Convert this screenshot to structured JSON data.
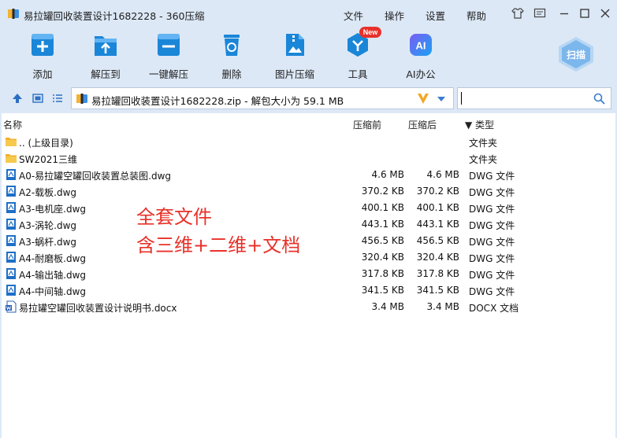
{
  "window": {
    "title": "易拉罐回收装置设计1682228 - 360压缩",
    "menus": [
      "文件",
      "操作",
      "设置",
      "帮助"
    ]
  },
  "toolbar": {
    "items": [
      {
        "label": "添加",
        "icon": "add-icon"
      },
      {
        "label": "解压到",
        "icon": "extract-to-icon"
      },
      {
        "label": "一键解压",
        "icon": "one-click-extract-icon"
      },
      {
        "label": "删除",
        "icon": "delete-icon"
      },
      {
        "label": "图片压缩",
        "icon": "image-compress-icon"
      },
      {
        "label": "工具",
        "icon": "tools-icon"
      },
      {
        "label": "AI办公",
        "icon": "ai-office-icon"
      }
    ],
    "new_badge": "New",
    "ai_text": "AI",
    "scan_label": "扫描"
  },
  "address": {
    "path": "易拉罐回收装置设计1682228.zip - 解包大小为 59.1 MB"
  },
  "columns": {
    "name": "名称",
    "packed": "压缩前",
    "unpacked": "压缩后",
    "type": "▼ 类型"
  },
  "files": [
    {
      "name": ".. (上级目录)",
      "packed": "",
      "unpacked": "",
      "type": "文件夹",
      "icon": "folder-icon"
    },
    {
      "name": "SW2021三维",
      "packed": "",
      "unpacked": "",
      "type": "文件夹",
      "icon": "folder-icon"
    },
    {
      "name": "A0-易拉罐空罐回收装置总装图.dwg",
      "packed": "4.6 MB",
      "unpacked": "4.6 MB",
      "type": "DWG 文件",
      "icon": "dwg-file-icon"
    },
    {
      "name": "A2-载板.dwg",
      "packed": "370.2 KB",
      "unpacked": "370.2 KB",
      "type": "DWG 文件",
      "icon": "dwg-file-icon"
    },
    {
      "name": "A3-电机座.dwg",
      "packed": "400.1 KB",
      "unpacked": "400.1 KB",
      "type": "DWG 文件",
      "icon": "dwg-file-icon"
    },
    {
      "name": "A3-涡轮.dwg",
      "packed": "443.1 KB",
      "unpacked": "443.1 KB",
      "type": "DWG 文件",
      "icon": "dwg-file-icon"
    },
    {
      "name": "A3-蜗杆.dwg",
      "packed": "456.5 KB",
      "unpacked": "456.5 KB",
      "type": "DWG 文件",
      "icon": "dwg-file-icon"
    },
    {
      "name": "A4-耐磨板.dwg",
      "packed": "320.4 KB",
      "unpacked": "320.4 KB",
      "type": "DWG 文件",
      "icon": "dwg-file-icon"
    },
    {
      "name": "A4-输出轴.dwg",
      "packed": "317.8 KB",
      "unpacked": "317.8 KB",
      "type": "DWG 文件",
      "icon": "dwg-file-icon"
    },
    {
      "name": "A4-中间轴.dwg",
      "packed": "341.5 KB",
      "unpacked": "341.5 KB",
      "type": "DWG 文件",
      "icon": "dwg-file-icon"
    },
    {
      "name": "易拉罐空罐回收装置设计说明书.docx",
      "packed": "3.4 MB",
      "unpacked": "3.4 MB",
      "type": "DOCX 文档",
      "icon": "docx-file-icon"
    }
  ],
  "annotation": {
    "line1": "全套文件",
    "line2": "含三维+二维+文档"
  },
  "colors": {
    "accent": "#1a86d8",
    "annotation": "#e8322a",
    "chrome": "#dce8f6"
  }
}
